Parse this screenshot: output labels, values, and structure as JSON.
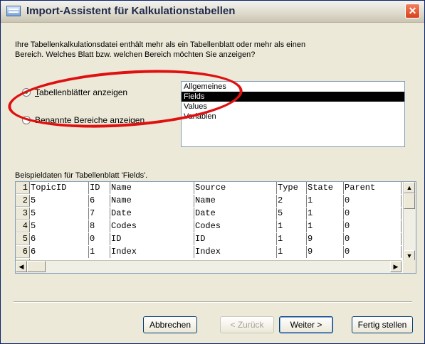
{
  "window": {
    "title": "Import-Assistent für Kalkulationstabellen",
    "close_glyph": "✕"
  },
  "intro": {
    "line1": "Ihre Tabellenkalkulationsdatei enthält mehr als ein Tabellenblatt oder mehr als einen",
    "line2": "Bereich. Welches Blatt bzw. welchen Bereich möchten Sie anzeigen?"
  },
  "options": {
    "sheets": {
      "label_first": "T",
      "label_rest": "abellenblätter anzeigen",
      "checked": true
    },
    "ranges": {
      "label": "Benannte Bereiche anzeigen",
      "checked": false
    }
  },
  "sheet_list": {
    "items": [
      "Allgemeines",
      "Fields",
      "Values",
      "Variablen"
    ],
    "selected": "Fields"
  },
  "preview": {
    "label": "Beispieldaten für Tabellenblatt 'Fields'.",
    "rows": [
      {
        "n": "1",
        "cells": [
          "TopicID",
          "ID",
          "Name",
          "Source",
          "Type",
          "State",
          "Parent"
        ]
      },
      {
        "n": "2",
        "cells": [
          "5",
          "6",
          "Name",
          "Name",
          "2",
          "1",
          "0"
        ]
      },
      {
        "n": "3",
        "cells": [
          "5",
          "7",
          "Date",
          "Date",
          "5",
          "1",
          "0"
        ]
      },
      {
        "n": "4",
        "cells": [
          "5",
          "8",
          "Codes",
          "Codes",
          "1",
          "1",
          "0"
        ]
      },
      {
        "n": "5",
        "cells": [
          "6",
          "0",
          "ID",
          "ID",
          "1",
          "9",
          "0"
        ]
      },
      {
        "n": "6",
        "cells": [
          "6",
          "1",
          "Index",
          "Index",
          "1",
          "9",
          "0"
        ]
      }
    ]
  },
  "buttons": {
    "cancel": "Abbrechen",
    "back": "< Zurück",
    "next": "Weiter >",
    "finish": "Fertig stellen"
  },
  "colors": {
    "annotation": "#e01010",
    "selection": "#000000"
  }
}
